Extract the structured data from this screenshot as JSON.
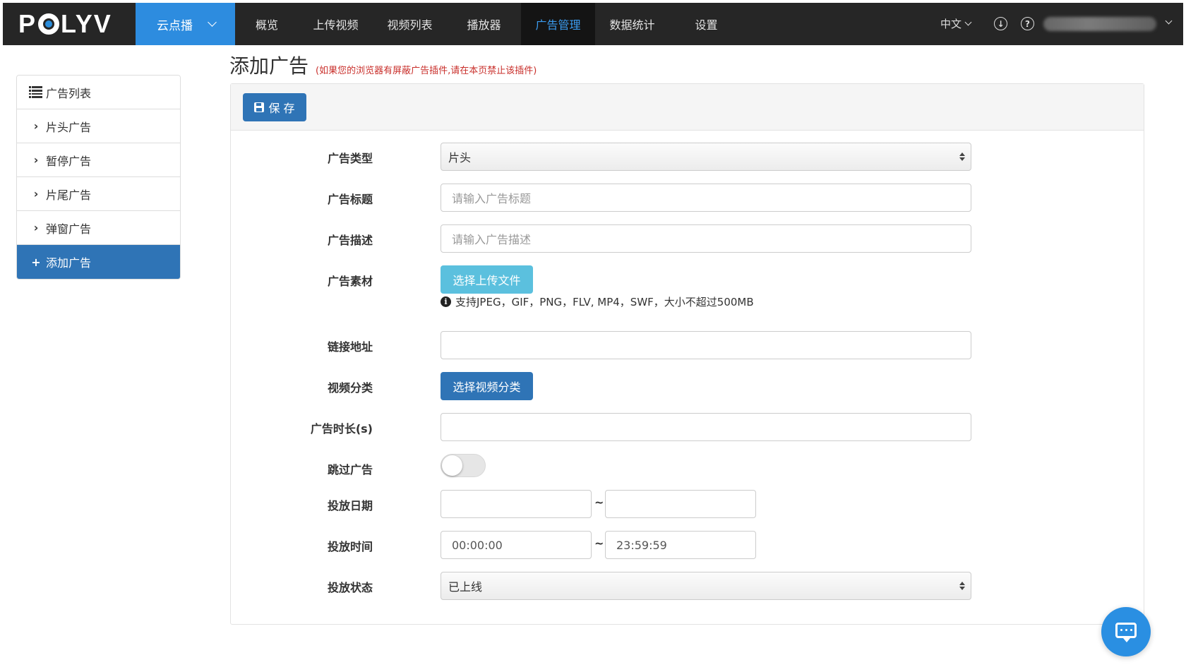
{
  "brand": {
    "logo_text": "POLYV",
    "product": "云点播",
    "accent": "#2d8cdf",
    "active_nav_color": "#3b9cf0"
  },
  "nav": {
    "items": [
      {
        "label": "概览"
      },
      {
        "label": "上传视频"
      },
      {
        "label": "视频列表"
      },
      {
        "label": "播放器"
      },
      {
        "label": "广告管理",
        "active": true
      },
      {
        "label": "数据统计"
      },
      {
        "label": "设置"
      }
    ],
    "language": "中文",
    "download_icon": "download-icon",
    "help_icon": "help-icon"
  },
  "sidebar": {
    "items": [
      {
        "label": "广告列表",
        "icon": "list-icon"
      },
      {
        "label": "片头广告",
        "icon": "chevron-right-icon"
      },
      {
        "label": "暂停广告",
        "icon": "chevron-right-icon"
      },
      {
        "label": "片尾广告",
        "icon": "chevron-right-icon"
      },
      {
        "label": "弹窗广告",
        "icon": "chevron-right-icon"
      },
      {
        "label": "添加广告",
        "icon": "plus-icon",
        "active": true
      }
    ]
  },
  "page": {
    "title": "添加广告",
    "warning": "(如果您的浏览器有屏蔽广告插件,请在本页禁止该插件)",
    "save_label": "保 存"
  },
  "form": {
    "ad_type": {
      "label": "广告类型",
      "value": "片头"
    },
    "ad_title": {
      "label": "广告标题",
      "placeholder": "请输入广告标题"
    },
    "ad_desc": {
      "label": "广告描述",
      "placeholder": "请输入广告描述"
    },
    "ad_material": {
      "label": "广告素材",
      "button": "选择上传文件",
      "hint": "支持JPEG，GIF，PNG，FLV, MP4，SWF，大小不超过500MB"
    },
    "link": {
      "label": "链接地址",
      "value": ""
    },
    "category": {
      "label": "视频分类",
      "button": "选择视频分类"
    },
    "duration": {
      "label": "广告时长(s)",
      "value": ""
    },
    "skip": {
      "label": "跳过广告",
      "enabled": false
    },
    "date": {
      "label": "投放日期",
      "from": "",
      "to": "",
      "separator": "~"
    },
    "time": {
      "label": "投放时间",
      "from": "00:00:00",
      "to": "23:59:59",
      "separator": "~"
    },
    "status": {
      "label": "投放状态",
      "value": "已上线"
    }
  },
  "chat": {
    "icon": "chat-icon"
  }
}
